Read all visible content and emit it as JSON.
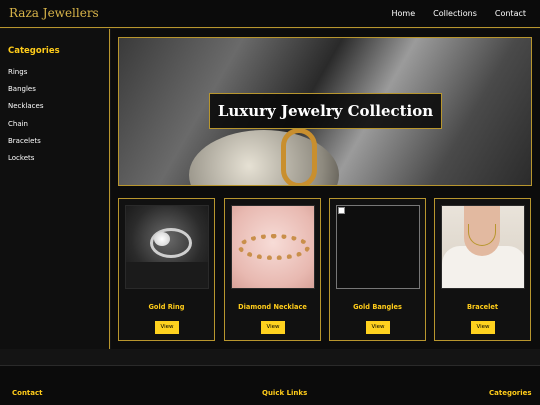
{
  "header": {
    "brand": "Raza Jewellers",
    "nav": [
      "Home",
      "Collections",
      "Contact"
    ]
  },
  "sidebar": {
    "title": "Categories",
    "items": [
      "Rings",
      "Bangles",
      "Necklaces",
      "Chain",
      "Bracelets",
      "Lockets"
    ]
  },
  "hero": {
    "title": "Luxury Jewelry Collection"
  },
  "products": [
    {
      "name": "Gold Ring",
      "button": "View",
      "image": "ring-photo"
    },
    {
      "name": "Diamond Necklace",
      "button": "View",
      "image": "bracelet-photo"
    },
    {
      "name": "Gold Bangles",
      "button": "View",
      "image": "broken-image"
    },
    {
      "name": "Bracelet",
      "button": "View",
      "image": "necklace-model-photo"
    }
  ],
  "footer": {
    "headings": [
      "Contact",
      "Quick Links",
      "Categories"
    ]
  },
  "colors": {
    "accent": "#ffcc1a",
    "border_gold": "#b8962e",
    "background": "#141414"
  }
}
